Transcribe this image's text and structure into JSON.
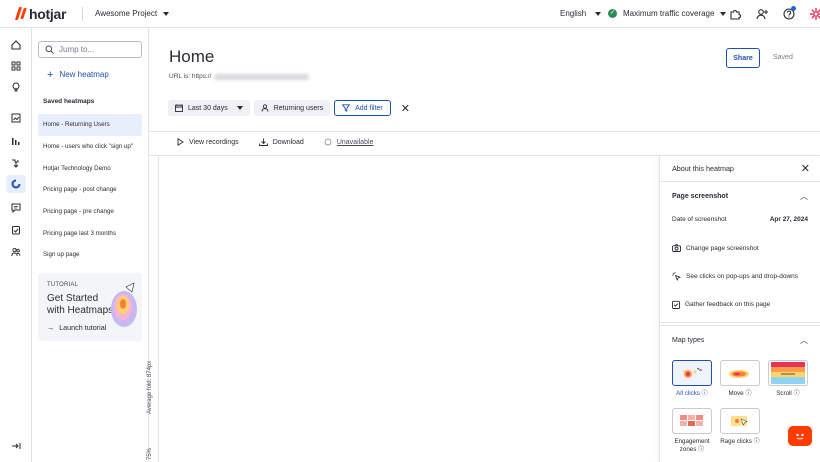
{
  "topbar": {
    "logo_text": "hotjar",
    "project": "Awesome Project",
    "language": "English",
    "coverage": "Maximum traffic coverage"
  },
  "sidebar": {
    "search_placeholder": "Jump to...",
    "new_heatmap": "New heatmap",
    "saved_title": "Saved heatmaps",
    "saved_items": [
      "Home - Returning Users",
      "Home - users who click \"sign up\"",
      "Hotjar Technology Demo",
      "Pricing page - post change",
      "Pricing page - pre change",
      "Pricing page last 3 months",
      "Sign up page"
    ],
    "active_index": 0,
    "tutorial": {
      "tag": "TUTORIAL",
      "title": "Get Started with Heatmaps",
      "launch": "Launch tutorial"
    }
  },
  "main": {
    "title": "Home",
    "url_prefix": "URL is: https://",
    "share": "Share",
    "saved": "Saved",
    "filters": {
      "date": "Last 30 days",
      "segment": "Returning users",
      "add_filter": "Add filter"
    },
    "toolbar": {
      "recordings": "View recordings",
      "download": "Download",
      "unavailable": "Unavailable"
    },
    "fold_label": "Average fold: 874px",
    "fold_percent": "75%"
  },
  "panel": {
    "title": "About this heatmap",
    "screenshot_section": "Page screenshot",
    "date_label": "Date of screenshot",
    "date_value": "Apr 27, 2024",
    "change_screenshot": "Change page screenshot",
    "popups": "See clicks on pop-ups and drop-downs",
    "feedback": "Gather feedback on this page",
    "map_types_title": "Map types",
    "map_types": {
      "all_clicks": "All clicks ⓘ",
      "move": "Move ⓘ",
      "scroll": "Scroll ⓘ",
      "engagement": "Engagement zones ⓘ",
      "rage": "Rage clicks ⓘ"
    }
  },
  "colors": {
    "brand": "#ff3c00",
    "accent": "#1f4fb4",
    "status_ok": "#2e8b57"
  }
}
